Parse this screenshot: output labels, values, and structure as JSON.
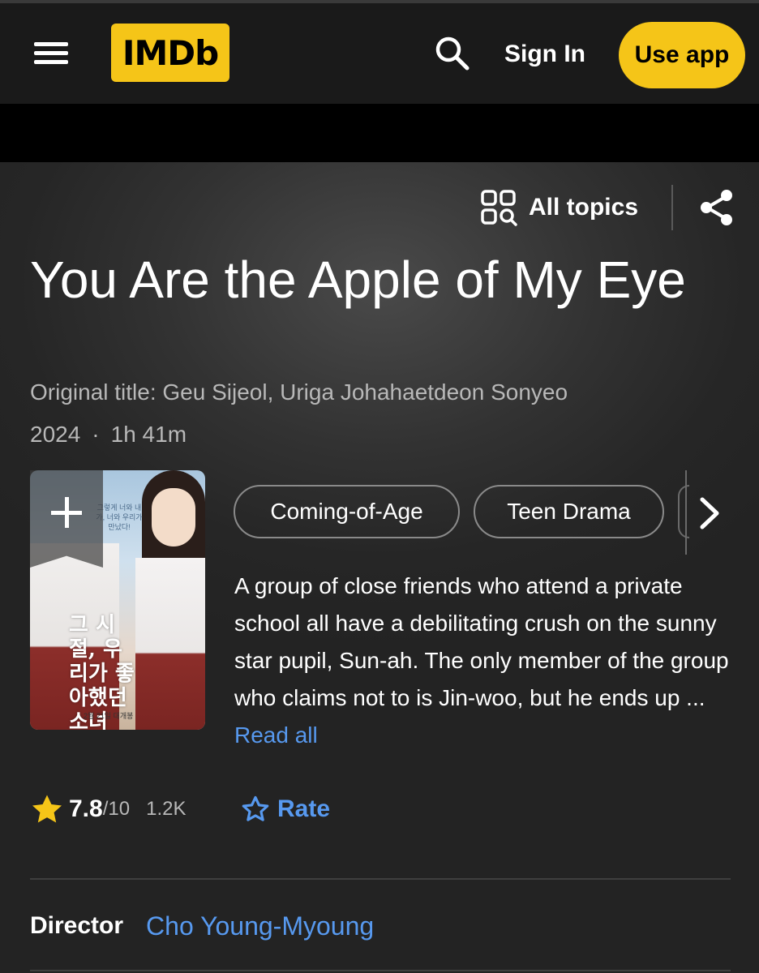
{
  "header": {
    "logo_text": "IMDb",
    "sign_in_label": "Sign In",
    "use_app_label": "Use app"
  },
  "hero": {
    "all_topics_label": "All topics",
    "title": "You Are the Apple of My Eye",
    "original_title": "Original title: Geu Sijeol, Uriga Johahaetdeon Sonyeo",
    "year": "2024",
    "separator": "·",
    "runtime": "1h 41m",
    "poster": {
      "korean_title": "그 시절, 우리가 좋아했던 소녀",
      "tagline": "그렇게 너와 내가, 너와 우리가 만났다!",
      "release_date": "2월 21일 대개봉"
    },
    "genres": [
      "Coming-of-Age",
      "Teen Drama"
    ],
    "plot": "A group of close friends who attend a private school all have a debilitating crush on the sunny star pupil, Sun-ah. The only member of the group who claims not to is Jin-woo, but he ends up ...",
    "read_all_label": "Read all"
  },
  "rating": {
    "score": "7.8",
    "out_of": "/10",
    "count": "1.2K",
    "rate_label": "Rate"
  },
  "credits": {
    "director_label": "Director",
    "director_name": "Cho Young-Myoung"
  },
  "colors": {
    "brand_yellow": "#f5c518",
    "link_blue": "#5799ef",
    "background": "#1f1f1f"
  },
  "icons": [
    "menu-icon",
    "search-icon",
    "all-topics-icon",
    "share-icon",
    "add-watchlist-icon",
    "chevron-right-icon",
    "star-icon",
    "star-outline-icon"
  ]
}
